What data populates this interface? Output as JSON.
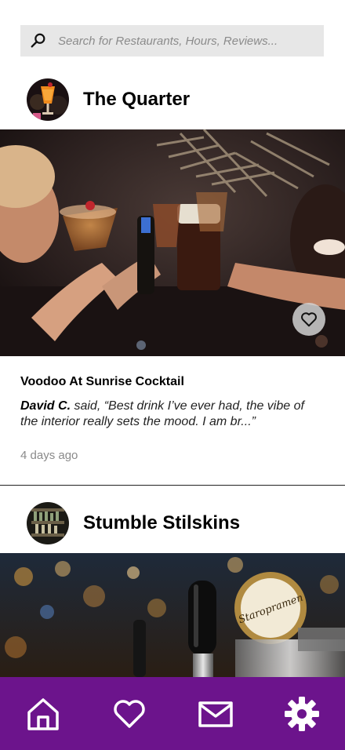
{
  "search": {
    "placeholder": "Search for Restaurants, Hours, Reviews..."
  },
  "feed": [
    {
      "venue_name": "The Quarter",
      "review": {
        "title": "Voodoo At Sunrise Cocktail",
        "author": "David C.",
        "said": " said, “Best drink I’ve ever had, the vibe of the interior really sets the mood. I am br...”",
        "time": "4 days ago"
      }
    },
    {
      "venue_name": "Stumble Stilskins"
    }
  ],
  "tabbar": {
    "items": [
      "home-icon",
      "heart-icon",
      "mail-icon",
      "gear-icon"
    ]
  },
  "colors": {
    "tabbar_bg": "#6c148c",
    "search_bg": "#e7e7e7",
    "time_text": "#8a8a8a"
  }
}
